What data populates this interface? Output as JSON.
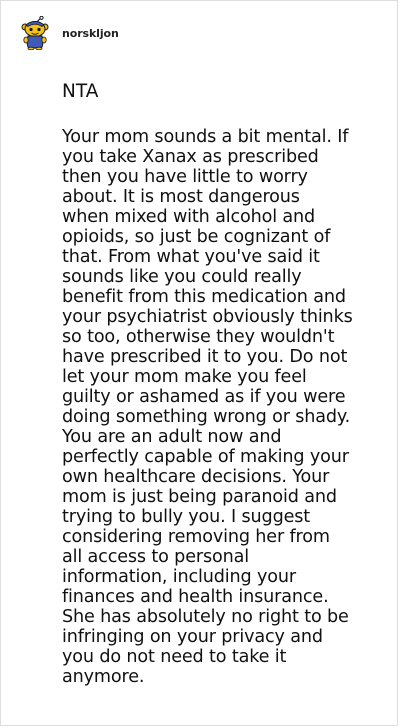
{
  "post": {
    "username": "norskljon",
    "verdict": "NTA",
    "lines": [
      "Your mom sounds a bit mental. If",
      "you take Xanax as prescribed",
      "then you have little to worry",
      "about. It is most dangerous",
      "when mixed with alcohol and",
      "opioids, so just be cognizant of",
      "that. From what you've said it",
      "sounds like you could really",
      "benefit from this medication and",
      "your psychiatrist obviously thinks",
      "so too, otherwise they wouldn't",
      "have prescribed it to you. Do not",
      "let your mom make you feel",
      "guilty or ashamed as if you were",
      "doing something wrong or shady.",
      "You are an adult now and",
      "perfectly capable of making your",
      "own healthcare decisions. Your",
      "mom is just being paranoid and",
      "trying to bully you. I suggest",
      "considering removing her from",
      "all access to personal",
      "information, including your",
      "finances and health insurance.",
      "She has absolutely no right to be",
      "infringing on your privacy and",
      "you do not need to take it",
      "anymore."
    ]
  },
  "avatar": {
    "icon": "snoo-avatar-icon",
    "colors": {
      "body": "#f2c21a",
      "hat": "#3f5ab8",
      "outline": "#1a1a1a"
    }
  }
}
